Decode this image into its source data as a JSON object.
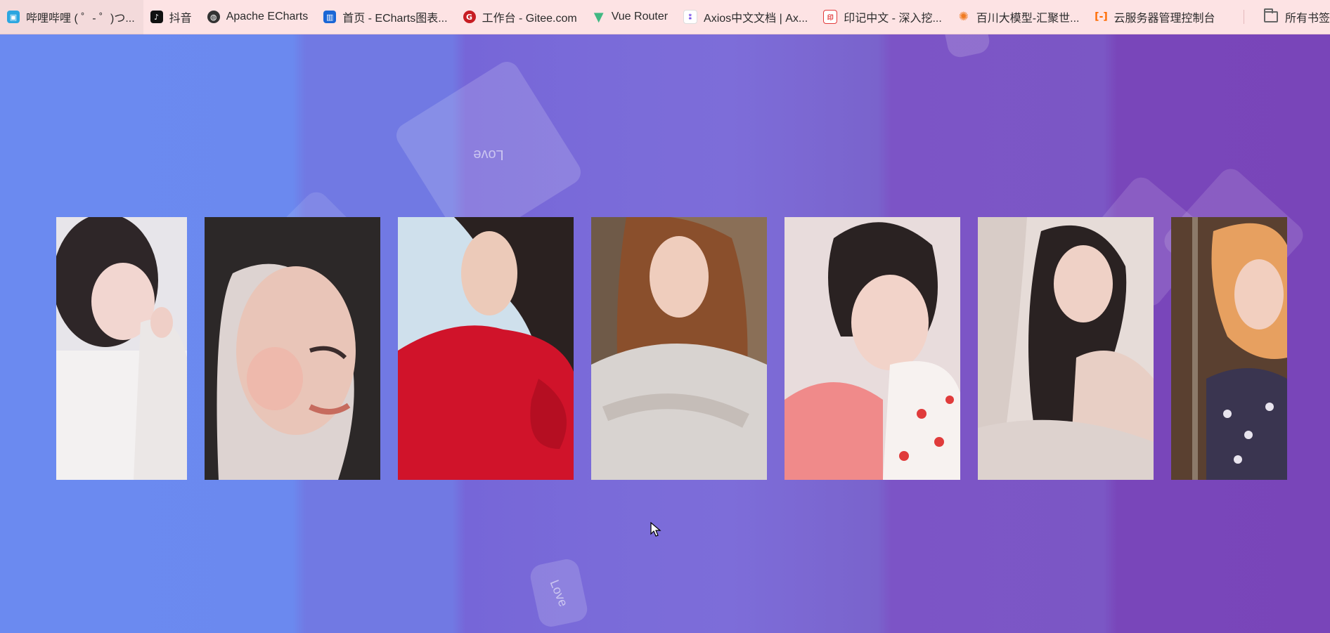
{
  "bookmarks": [
    {
      "label": "哔哩哔哩 ( ゜- ゜)つ...",
      "icon": "bilibili-icon",
      "color": "#2ba6e0"
    },
    {
      "label": "抖音",
      "icon": "douyin-icon",
      "color": "#111111"
    },
    {
      "label": "Apache ECharts",
      "icon": "globe-icon",
      "color": "#333333"
    },
    {
      "label": "首页 - ECharts图表...",
      "icon": "echarts-chart-icon",
      "color": "#1a66d6"
    },
    {
      "label": "工作台 - Gitee.com",
      "icon": "gitee-icon",
      "color": "#c71d23"
    },
    {
      "label": "Vue Router",
      "icon": "vue-icon",
      "color": "#41b883"
    },
    {
      "label": "Axios中文文档 | Ax...",
      "icon": "axios-icon",
      "color": "#5a29e4"
    },
    {
      "label": "印记中文 - 深入挖...",
      "icon": "yinji-icon",
      "color": "#e23a3a"
    },
    {
      "label": "百川大模型-汇聚世...",
      "icon": "baichuan-icon",
      "color": "#f07a21"
    },
    {
      "label": "云服务器管理控制台",
      "icon": "aliyun-icon",
      "color": "#ff6a00"
    }
  ],
  "all_bookmarks_label": "所有书签",
  "deco_text": "Love",
  "photos": [
    {
      "name": "photo-1",
      "bg": "#e9e6ea",
      "hair": "#2b2426",
      "cloth": "#f4f2f2"
    },
    {
      "name": "photo-2",
      "bg": "#d9d0cf",
      "hair": "#2c2828",
      "cloth": "#c7b8b4"
    },
    {
      "name": "photo-3",
      "bg": "#cfe0ec",
      "hair": "#2a2120",
      "cloth": "#d0132a"
    },
    {
      "name": "photo-4",
      "bg": "#8a6f57",
      "hair": "#8a4f2c",
      "cloth": "#d8d3d0"
    },
    {
      "name": "photo-5",
      "bg": "#e8dcdc",
      "hair": "#2a2222",
      "cloth": "#f08a8a"
    },
    {
      "name": "photo-6",
      "bg": "#e6dcd8",
      "hair": "#2a2222",
      "cloth": "#ddd2ce"
    },
    {
      "name": "photo-7",
      "bg": "#5a4030",
      "hair": "#e7a060",
      "cloth": "#3a3550"
    }
  ]
}
